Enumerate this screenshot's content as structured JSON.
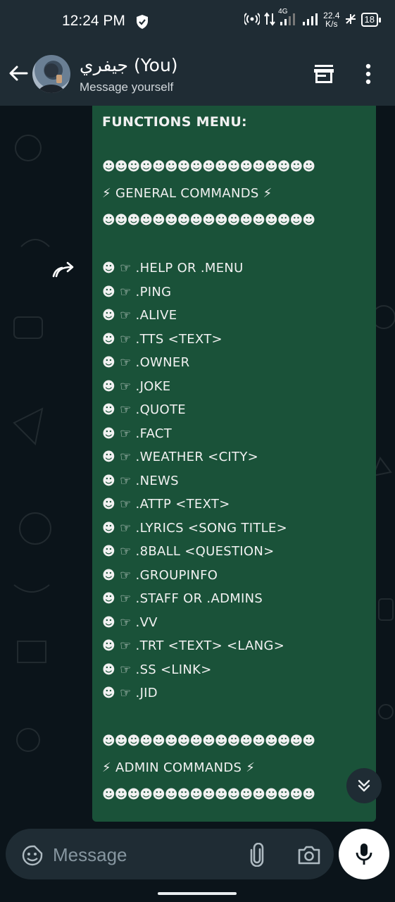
{
  "status": {
    "time": "12:24 PM",
    "network": "4G",
    "speed_value": "22.4",
    "speed_unit": "K/s",
    "battery": "18"
  },
  "header": {
    "contact_name": "جيفري (You)",
    "subtitle": "Message yourself"
  },
  "message": {
    "title": "FUNCTIONS MENU:",
    "emoji_row": "☻☻☻☻☻☻☻☻☻☻☻☻☻☻☻☻☻",
    "general_heading": "⚡ GENERAL COMMANDS ⚡",
    "commands": [
      "☻ ☞ .HELP OR .MENU",
      "☻ ☞ .PING",
      "☻ ☞ .ALIVE",
      "☻ ☞ .TTS <TEXT>",
      "☻ ☞ .OWNER",
      "☻ ☞ .JOKE",
      "☻ ☞ .QUOTE",
      "☻ ☞ .FACT",
      "☻ ☞ .WEATHER <CITY>",
      "☻ ☞ .NEWS",
      "☻ ☞ .ATTP <TEXT>",
      "☻ ☞ .LYRICS <SONG TITLE>",
      "☻ ☞ .8BALL <QUESTION>",
      "☻ ☞ .GROUPINFO",
      "☻ ☞ .STAFF OR .ADMINS",
      "☻ ☞ .VV",
      "☻ ☞ .TRT <TEXT> <LANG>",
      "☻ ☞ .SS <LINK>",
      "☻ ☞ .JID"
    ],
    "admin_heading": "⚡ ADMIN COMMANDS ⚡"
  },
  "composer": {
    "placeholder": "Message"
  },
  "colors": {
    "bubble": "#1a5239",
    "bar": "#1f2c34",
    "background": "#0b141a"
  }
}
